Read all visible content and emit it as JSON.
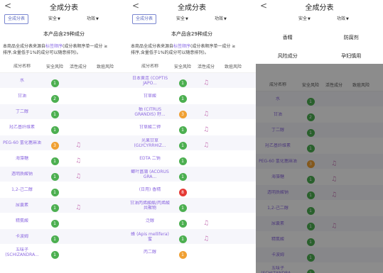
{
  "nav": {
    "title": "全成分表"
  },
  "filters": {
    "all": "全成分表",
    "safety": "安全",
    "effect": "功效"
  },
  "summary": {
    "count_text": "本产品含29种成分"
  },
  "note": {
    "line1_pre": "本商品全成分表来源自",
    "line1_link": "标签顺序",
    "line1_post": "(成分表顺序单一成分 ≥",
    "line2": "排序,含量低于1%的成分可以随意排列)。"
  },
  "table_header": {
    "name": "成分名称",
    "safety": "安全风险",
    "active": "活性成分",
    "acne": "致痘风险"
  },
  "colors": {
    "green": "#4caf50",
    "orange": "#f0a033",
    "red": "#e53935",
    "purple": "#8d6ae0"
  },
  "active_icon": "♫",
  "panel_a_rows": [
    {
      "name": "水",
      "level": "1",
      "color": "green",
      "active": false
    },
    {
      "name": "甘油",
      "level": "2",
      "color": "green",
      "active": false
    },
    {
      "name": "丁二醇",
      "level": "1",
      "color": "green",
      "active": false
    },
    {
      "name": "羟乙基纤维素",
      "level": "1",
      "color": "green",
      "active": false
    },
    {
      "name": "PEG-60 氢化蓖麻油",
      "level": "3",
      "color": "orange",
      "active": true
    },
    {
      "name": "海藻糖",
      "level": "1",
      "color": "green",
      "active": true
    },
    {
      "name": "透明质酸钠",
      "level": "1",
      "color": "green",
      "active": true
    },
    {
      "name": "1,2-己二醇",
      "level": "1",
      "color": "green",
      "active": false
    },
    {
      "name": "尿囊素",
      "level": "1",
      "color": "green",
      "active": true
    },
    {
      "name": "精氨酸",
      "level": "1",
      "color": "green",
      "active": false
    },
    {
      "name": "卡波姆",
      "level": "1",
      "color": "green",
      "active": false
    },
    {
      "name": "五味子 (SCHIZANDRA...",
      "level": "1",
      "color": "green",
      "active": false
    }
  ],
  "panel_b_rows": [
    {
      "name": "日本黄连 (COPTIS JAPO...",
      "level": "1",
      "color": "green",
      "active": true
    },
    {
      "name": "甘草酸",
      "level": "1",
      "color": "green",
      "active": false
    },
    {
      "name": "柚 (CITRUS GRANDIS) 籽...",
      "level": "3",
      "color": "orange",
      "active": true
    },
    {
      "name": "甘草酸二钾",
      "level": "1",
      "color": "green",
      "active": true
    },
    {
      "name": "光果甘草 (GLYCYRRHIZ...",
      "level": "1",
      "color": "green",
      "active": true
    },
    {
      "name": "EDTA 二钠",
      "level": "1",
      "color": "green",
      "active": false
    },
    {
      "name": "鲫叶菖蒲 (ACORUS GRA...",
      "level": "1",
      "color": "green",
      "active": false
    },
    {
      "name": "(日用) 香精",
      "level": "8",
      "color": "red",
      "active": false
    },
    {
      "name": "甘油丙烯酸酯/丙烯酸共聚物",
      "level": "1",
      "color": "green",
      "active": false
    },
    {
      "name": "泛醇",
      "level": "1",
      "color": "green",
      "active": true
    },
    {
      "name": "蜂 (Apis mellifera) 蜜",
      "level": "1",
      "color": "green",
      "active": true
    },
    {
      "name": "丙二醇",
      "level": "1",
      "color": "orange",
      "active": false
    }
  ],
  "panel_c_categories": [
    {
      "left": "香精",
      "right": "防腐剂"
    },
    {
      "left": "风险成分",
      "right": "孕妇慎用"
    }
  ]
}
